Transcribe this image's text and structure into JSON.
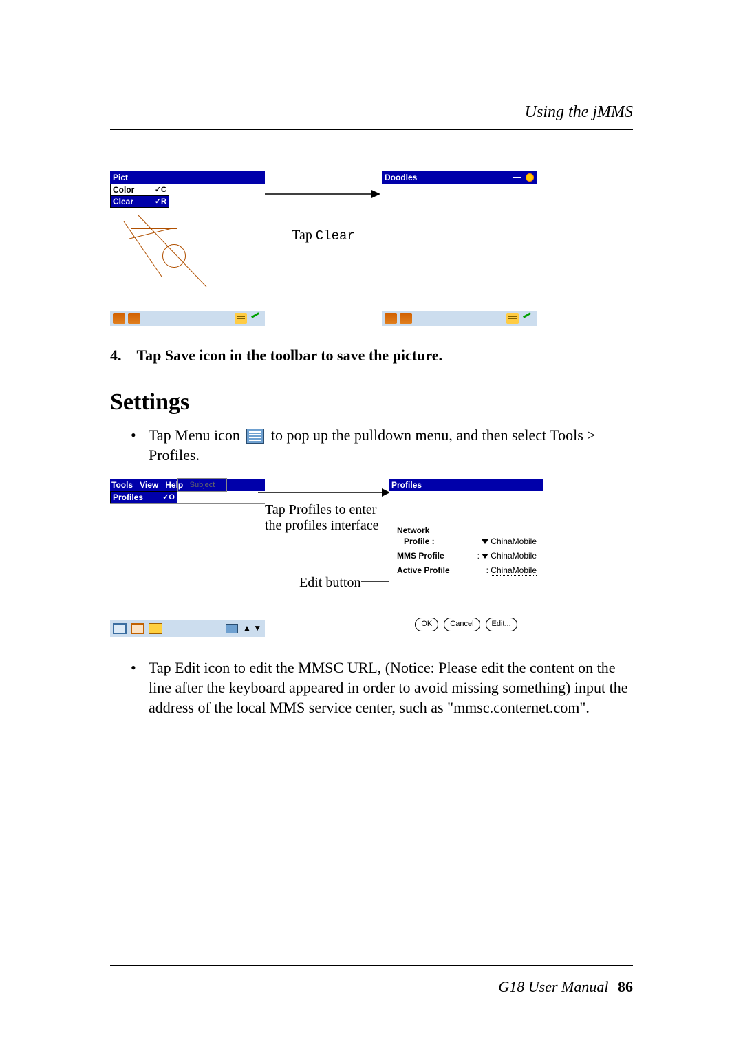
{
  "header": {
    "section_title": "Using the jMMS"
  },
  "footer": {
    "manual_title": "G18 User Manual",
    "page_number": "86"
  },
  "fig1": {
    "left_title": "Pict",
    "menu": {
      "color_label": "Color",
      "color_shortcut": "✓C",
      "clear_label": "Clear",
      "clear_shortcut": "✓R"
    },
    "arrow_label_prefix": "Tap ",
    "arrow_label_code": "Clear",
    "right_title": "Doodles"
  },
  "step4": {
    "number": "4.",
    "text": "Tap Save icon in the toolbar to save the picture."
  },
  "settings_heading": "Settings",
  "bullet1": {
    "lead_text": "Tap Menu icon ",
    "tail_text": " to pop up the pulldown menu, and then select Tools > Profiles."
  },
  "fig2": {
    "menubar": {
      "tools": "Tools",
      "view": "View",
      "help": "Help"
    },
    "tools_menu": {
      "profiles_label": "Profiles",
      "profiles_shortcut": "✓O"
    },
    "subject_placeholder": "Subject",
    "note_top": "Tap Profiles to enter the profiles interface",
    "note_bottom": "Edit button",
    "right_title": "Profiles",
    "network_label": "Network",
    "profile_label": "Profile  :",
    "profile_value": "ChinaMobile",
    "mms_profile_label": "MMS Profile",
    "mms_profile_value": "ChinaMobile",
    "active_profile_label": "Active Profile",
    "active_profile_value": "ChinaMobile",
    "btn_ok": "OK",
    "btn_cancel": "Cancel",
    "btn_edit": "Edit..."
  },
  "bullet2": {
    "text": "Tap Edit icon to edit the MMSC URL, (Notice: Please edit the content on the line after the keyboard appeared in order to avoid missing something) input the address of the local MMS service center, such as \"mmsc.conternet.com\"."
  }
}
